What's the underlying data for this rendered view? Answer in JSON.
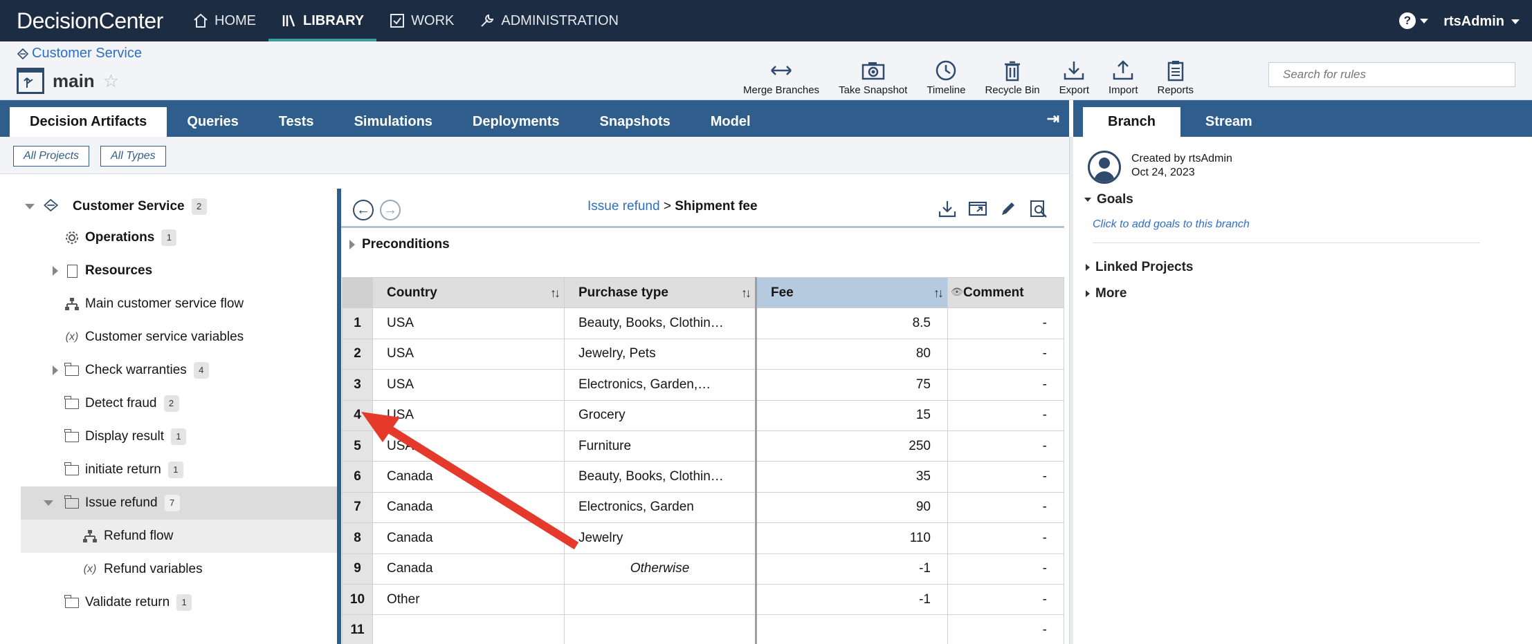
{
  "app": {
    "brand": "DecisionCenter",
    "nav": [
      {
        "label": "HOME",
        "icon": "home-icon"
      },
      {
        "label": "LIBRARY",
        "icon": "library-icon",
        "active": true
      },
      {
        "label": "WORK",
        "icon": "checkbox-icon"
      },
      {
        "label": "ADMINISTRATION",
        "icon": "wrench-icon"
      }
    ],
    "help_symbol": "?",
    "user": "rtsAdmin"
  },
  "header": {
    "breadcrumb": "Customer Service",
    "branch": "main",
    "tools": [
      {
        "label": "Merge Branches",
        "icon": "merge-icon"
      },
      {
        "label": "Take Snapshot",
        "icon": "camera-icon"
      },
      {
        "label": "Timeline",
        "icon": "clock-icon"
      },
      {
        "label": "Recycle Bin",
        "icon": "trash-icon"
      },
      {
        "label": "Export",
        "icon": "download-icon"
      },
      {
        "label": "Import",
        "icon": "upload-icon"
      },
      {
        "label": "Reports",
        "icon": "clipboard-icon"
      }
    ],
    "search_placeholder": "Search for rules"
  },
  "tabs": [
    "Decision Artifacts",
    "Queries",
    "Tests",
    "Simulations",
    "Deployments",
    "Snapshots",
    "Model"
  ],
  "filters": {
    "projects": "All Projects",
    "types": "All Types"
  },
  "tree": {
    "root": {
      "label": "Customer Service",
      "count": "2"
    },
    "items": [
      {
        "label": "Operations",
        "count": "1",
        "icon": "gear-icon",
        "bold": true
      },
      {
        "label": "Resources",
        "icon": "document-icon",
        "bold": true,
        "expandable": true
      },
      {
        "label": "Main customer service flow",
        "icon": "flow-icon"
      },
      {
        "label": "Customer service variables",
        "icon": "variable-icon"
      },
      {
        "label": "Check warranties",
        "count": "4",
        "icon": "folder-icon",
        "expandable": true
      },
      {
        "label": "Detect fraud",
        "count": "2",
        "icon": "folder-icon"
      },
      {
        "label": "Display result",
        "count": "1",
        "icon": "folder-icon"
      },
      {
        "label": "initiate return",
        "count": "1",
        "icon": "folder-icon"
      },
      {
        "label": "Issue refund",
        "count": "7",
        "icon": "folder-icon",
        "expanded": true,
        "selected": true
      },
      {
        "label": "Refund flow",
        "icon": "flow-icon",
        "child": true
      },
      {
        "label": "Refund variables",
        "icon": "variable-icon",
        "child": true
      },
      {
        "label": "Validate return",
        "count": "1",
        "icon": "folder-icon"
      }
    ]
  },
  "editor": {
    "crumb_link": "Issue refund",
    "crumb_sep": ">",
    "crumb_current": "Shipment fee",
    "preconditions": "Preconditions",
    "columns": [
      "Country",
      "Purchase type",
      "Fee",
      "Comment"
    ],
    "rows": [
      {
        "n": "1",
        "country": "USA",
        "type": "Beauty, Books, Clothin…",
        "fee": "8.5",
        "comment": "-"
      },
      {
        "n": "2",
        "country": "USA",
        "type": "Jewelry, Pets",
        "fee": "80",
        "comment": "-"
      },
      {
        "n": "3",
        "country": "USA",
        "type": "Electronics, Garden,…",
        "fee": "75",
        "comment": "-"
      },
      {
        "n": "4",
        "country": "USA",
        "type": "Grocery",
        "fee": "15",
        "comment": "-"
      },
      {
        "n": "5",
        "country": "USA",
        "type": "Furniture",
        "fee": "250",
        "comment": "-"
      },
      {
        "n": "6",
        "country": "Canada",
        "type": "Beauty, Books, Clothin…",
        "fee": "35",
        "comment": "-"
      },
      {
        "n": "7",
        "country": "Canada",
        "type": "Electronics, Garden",
        "fee": "90",
        "comment": "-"
      },
      {
        "n": "8",
        "country": "Canada",
        "type": "Jewelry",
        "fee": "110",
        "comment": "-"
      },
      {
        "n": "9",
        "country": "Canada",
        "type": "Otherwise",
        "fee": "-1",
        "comment": "-"
      },
      {
        "n": "10",
        "country": "Other",
        "type": "",
        "fee": "-1",
        "comment": "-"
      },
      {
        "n": "11",
        "country": "",
        "type": "",
        "fee": "",
        "comment": "-"
      }
    ]
  },
  "right_panel": {
    "tabs": [
      "Branch",
      "Stream"
    ],
    "created_by": "Created by rtsAdmin",
    "created_date": "Oct 24, 2023",
    "goals": "Goals",
    "add_goals": "Click to add goals to this branch",
    "linked_projects": "Linked Projects",
    "more": "More"
  },
  "colors": {
    "topbar": "#1c2c42",
    "tabbar": "#2f5d8c",
    "link": "#2d6fc4",
    "fee_header": "#b5c9df",
    "annotation_arrow": "#e53a2b"
  }
}
